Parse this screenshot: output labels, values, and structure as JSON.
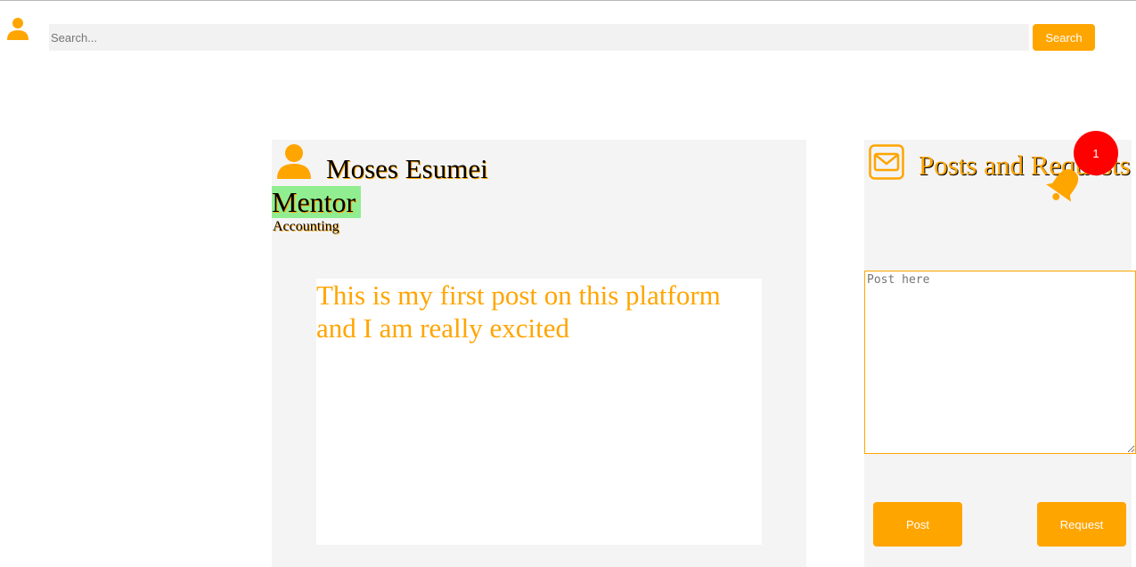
{
  "colors": {
    "accent": "#ffa500",
    "panel": "#f4f4f4",
    "badge_bg": "#90ee90",
    "notification": "#ff0000"
  },
  "header": {
    "avatar_icon": "user-icon",
    "search_placeholder": "Search...",
    "search_label": "Search"
  },
  "profile": {
    "avatar_icon": "user-icon",
    "name": "Moses Esumei",
    "role": "Mentor",
    "department": "Accounting",
    "posts": [
      {
        "text": "This is my first post on this platform and I am really excited"
      }
    ]
  },
  "sidebar": {
    "mail_icon": "envelope-icon",
    "title": "Posts and Requests",
    "bell_icon": "bell-icon",
    "notification_count": "1",
    "post_placeholder": "Post here",
    "post_label": "Post",
    "request_label": "Request"
  }
}
